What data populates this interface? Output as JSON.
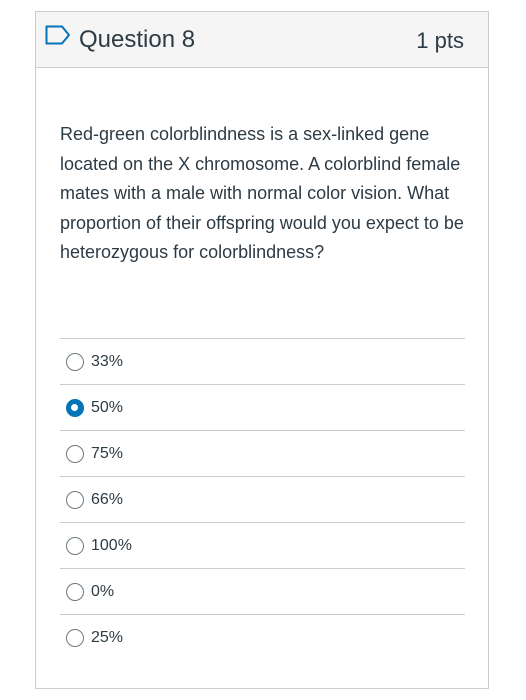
{
  "question": {
    "title": "Question 8",
    "points": "1 pts",
    "text": "Red-green colorblindness is a sex-linked gene located on the X chromosome. A colorblind female mates with a male with normal color vision. What proportion of their offspring would you expect to be heterozygous for colorblindness?",
    "flag_icon": "flag-outline-icon",
    "accent_color": "#0374b5",
    "answers": [
      {
        "label": "33%",
        "selected": false
      },
      {
        "label": "50%",
        "selected": true
      },
      {
        "label": "75%",
        "selected": false
      },
      {
        "label": "66%",
        "selected": false
      },
      {
        "label": "100%",
        "selected": false
      },
      {
        "label": "0%",
        "selected": false
      },
      {
        "label": "25%",
        "selected": false
      }
    ]
  }
}
